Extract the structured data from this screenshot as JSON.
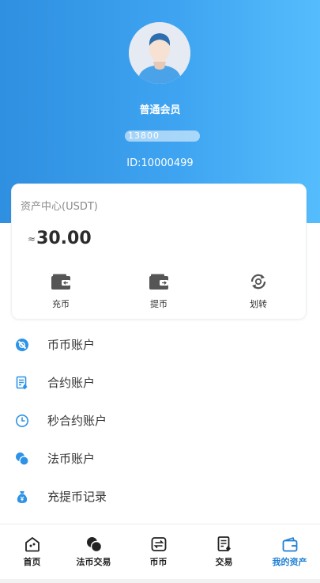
{
  "profile": {
    "member_level": "普通会员",
    "phone_masked": "13800",
    "user_id": "ID:10000499"
  },
  "assets": {
    "title": "资产中心(USDT)",
    "approx_symbol": "≈",
    "total": "30.00",
    "actions": [
      {
        "label": "充币",
        "icon": "wallet-in-icon"
      },
      {
        "label": "提币",
        "icon": "wallet-out-icon"
      },
      {
        "label": "划转",
        "icon": "transfer-icon"
      }
    ]
  },
  "menu": [
    {
      "label": "币币账户",
      "icon": "coin-account-icon"
    },
    {
      "label": "合约账户",
      "icon": "contract-icon"
    },
    {
      "label": "秒合约账户",
      "icon": "clock-icon"
    },
    {
      "label": "法币账户",
      "icon": "fiat-icon"
    },
    {
      "label": "充提币记录",
      "icon": "money-bag-icon"
    }
  ],
  "tabbar": [
    {
      "label": "首页",
      "icon": "home-icon",
      "active": false
    },
    {
      "label": "法币交易",
      "icon": "fiat-trade-icon",
      "active": false
    },
    {
      "label": "币币",
      "icon": "coin-exchange-icon",
      "active": false
    },
    {
      "label": "交易",
      "icon": "trade-icon",
      "active": false
    },
    {
      "label": "我的资产",
      "icon": "wallet-icon",
      "active": true
    }
  ],
  "colors": {
    "header_gradient_start": "#2f8fe0",
    "header_gradient_end": "#55bdfc",
    "accent": "#1f7fd2",
    "menu_icon": "#2e93e6"
  }
}
